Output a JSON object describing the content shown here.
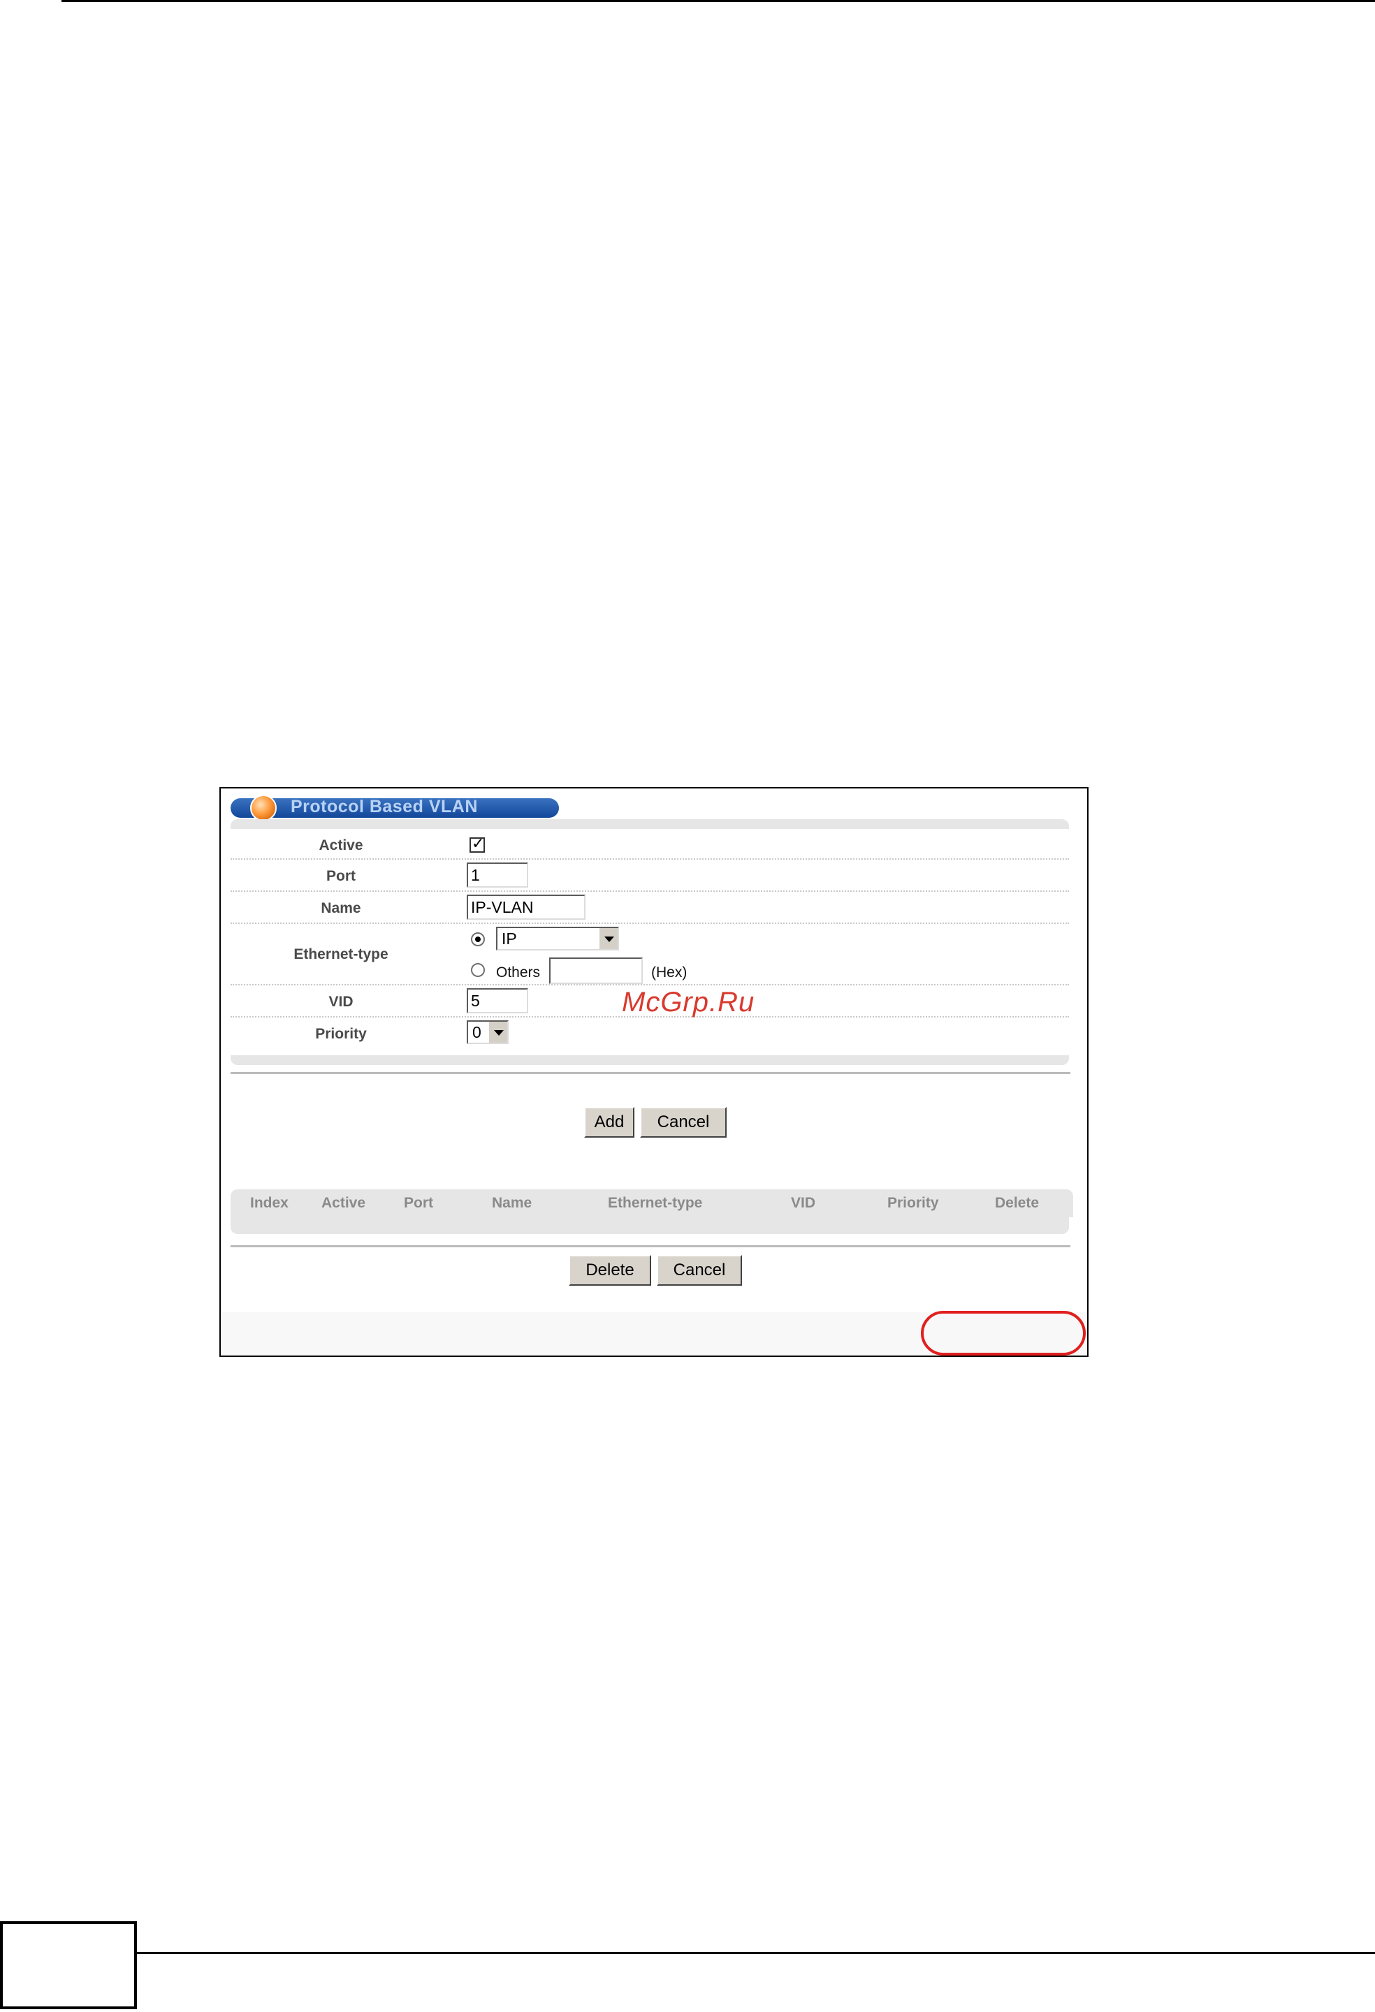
{
  "panel": {
    "title": "Protocol Based VLAN",
    "form": {
      "active_label": "Active",
      "active_checked": true,
      "port_label": "Port",
      "port_value": "1",
      "name_label": "Name",
      "name_value": "IP-VLAN",
      "ethernet_type_label": "Ethernet-type",
      "ethernet_type_selected": "IP",
      "others_label": "Others",
      "others_value": "",
      "hex_label": "(Hex)",
      "vid_label": "VID",
      "vid_value": "5",
      "priority_label": "Priority",
      "priority_value": "0"
    },
    "form_buttons": {
      "add": "Add",
      "cancel": "Cancel"
    },
    "table": {
      "columns": [
        "Index",
        "Active",
        "Port",
        "Name",
        "Ethernet-type",
        "VID",
        "Priority",
        "Delete"
      ],
      "rows": []
    },
    "table_buttons": {
      "delete": "Delete",
      "cancel": "Cancel"
    }
  },
  "watermark": "McGrp.Ru",
  "colors": {
    "title_bar": "#1a4fa0",
    "title_text": "#b8d2f5",
    "panel_gray": "#e6e6e6",
    "highlight": "#e0201e",
    "watermark": "#d83a2e"
  }
}
